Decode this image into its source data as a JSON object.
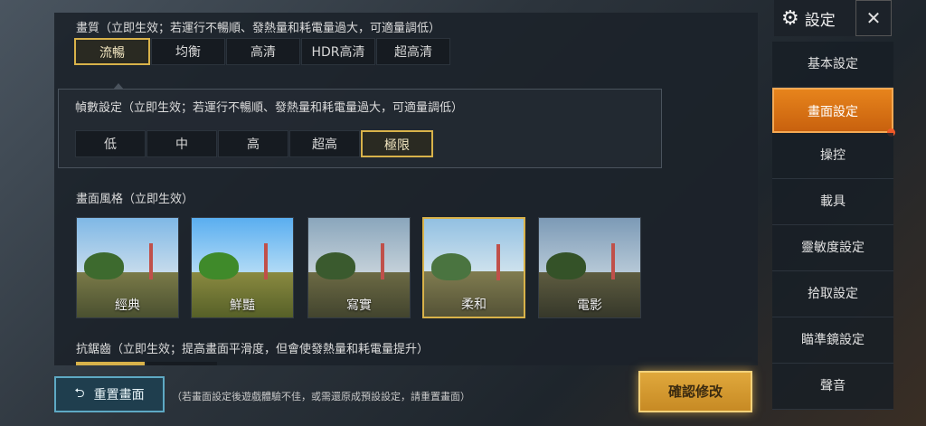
{
  "graphics": {
    "title": "畫質（立即生效；若運行不暢順、發熱量和耗電量過大，可適量調低）",
    "options": [
      "流暢",
      "均衡",
      "高清",
      "HDR高清",
      "超高清"
    ],
    "selected": 0
  },
  "frame_rate": {
    "title": "幀數設定（立即生效；若運行不暢順、發熱量和耗電量過大，可適量調低）",
    "options": [
      "低",
      "中",
      "高",
      "超高",
      "極限"
    ],
    "selected": 4
  },
  "style": {
    "title": "畫面風格（立即生效）",
    "options": [
      "經典",
      "鮮豔",
      "寫實",
      "柔和",
      "電影"
    ],
    "selected": 3
  },
  "antialias": {
    "title": "抗鋸齒（立即生效；提高畫面平滑度，但會使發熱量和耗電量提升）"
  },
  "footer": {
    "reset_label": "重置畫面",
    "hint": "（若畫面設定後遊戲體驗不佳，或需還原成預設設定，請重置畫面）",
    "confirm_label": "確認修改"
  },
  "sidebar": {
    "title": "設定",
    "items": [
      "基本設定",
      "畫面設定",
      "操控",
      "載具",
      "靈敏度設定",
      "拾取設定",
      "瞄準鏡設定",
      "聲音"
    ],
    "active": 1
  },
  "colors": {
    "accent_gold": "#d8b24a",
    "active_orange": "#e7841c",
    "reset_blue": "#5ea9c4"
  }
}
